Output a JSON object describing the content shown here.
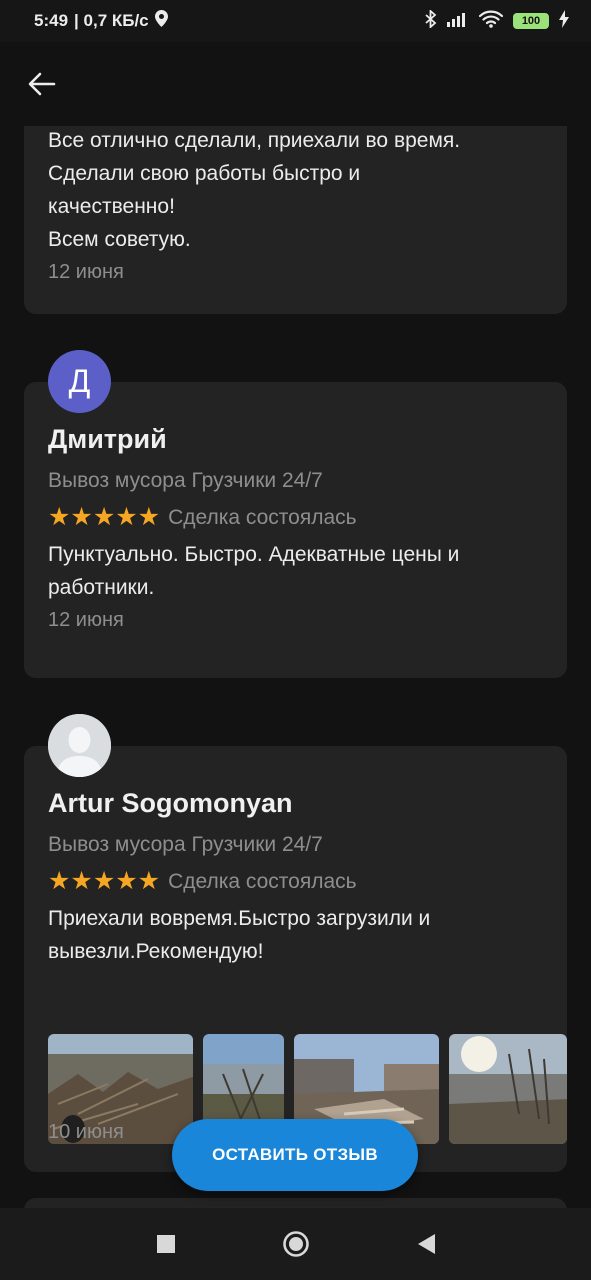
{
  "status_bar": {
    "time": "5:49",
    "speed": "| 0,7 КБ/с",
    "battery": "100"
  },
  "reviews": [
    {
      "text_lines": [
        "Все отлично сделали, приехали во время.",
        "Сделали свою работы быстро и",
        "качественно!",
        "Всем советую."
      ],
      "date": "12 июня"
    },
    {
      "avatar_letter": "Д",
      "avatar_color": "#5b5fc7",
      "name": "Дмитрий",
      "service": "Вывоз мусора Грузчики 24/7",
      "stars": "★★★★★",
      "rating": 5,
      "deal_status": "Сделка состоялась",
      "text_lines": [
        "Пунктуально. Быстро. Адекватные цены и",
        "работники."
      ],
      "date": "12 июня"
    },
    {
      "name": "Artur Sogomonyan",
      "service": "Вывоз мусора Грузчики 24/7",
      "stars": "★★★★★",
      "rating": 5,
      "deal_status": "Сделка состоялась",
      "text_lines": [
        "Приехали вовремя.Быстро загрузили и",
        "вывезли.Рекомендую!"
      ],
      "date": "10 июня"
    }
  ],
  "leave_review_button": "ОСТАВИТЬ ОТЗЫВ",
  "colors": {
    "accent": "#1a86d9",
    "star": "#f5a623",
    "card": "#232323",
    "background": "#121212"
  }
}
